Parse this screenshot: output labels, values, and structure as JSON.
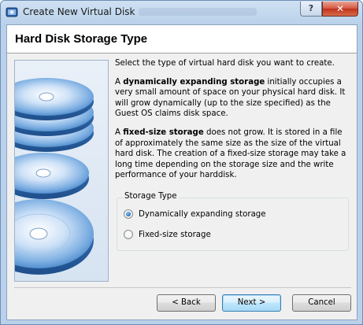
{
  "window": {
    "title": "Create New Virtual Disk",
    "help_label": "?",
    "close_label": "✕"
  },
  "page": {
    "title": "Hard Disk Storage Type"
  },
  "content": {
    "intro": "Select the type of virtual hard disk you want to create.",
    "dynamic_term": "dynamically expanding storage",
    "dynamic_prefix": "A ",
    "dynamic_rest": " initially occupies a very small amount of space on your physical hard disk. It will grow dynamically (up to the size specified) as the Guest OS claims disk space.",
    "fixed_prefix": "A ",
    "fixed_term": "fixed-size storage",
    "fixed_rest": " does not grow. It is stored in a file of approximately the same size as the size of the virtual hard disk. The creation of a fixed-size storage may take a long time depending on the storage size and the write performance of your harddisk."
  },
  "storage_type": {
    "label": "Storage Type",
    "options": [
      {
        "label": "Dynamically expanding storage",
        "selected": true
      },
      {
        "label": "Fixed-size storage",
        "selected": false
      }
    ]
  },
  "buttons": {
    "back": "< Back",
    "next": "Next >",
    "cancel": "Cancel"
  }
}
